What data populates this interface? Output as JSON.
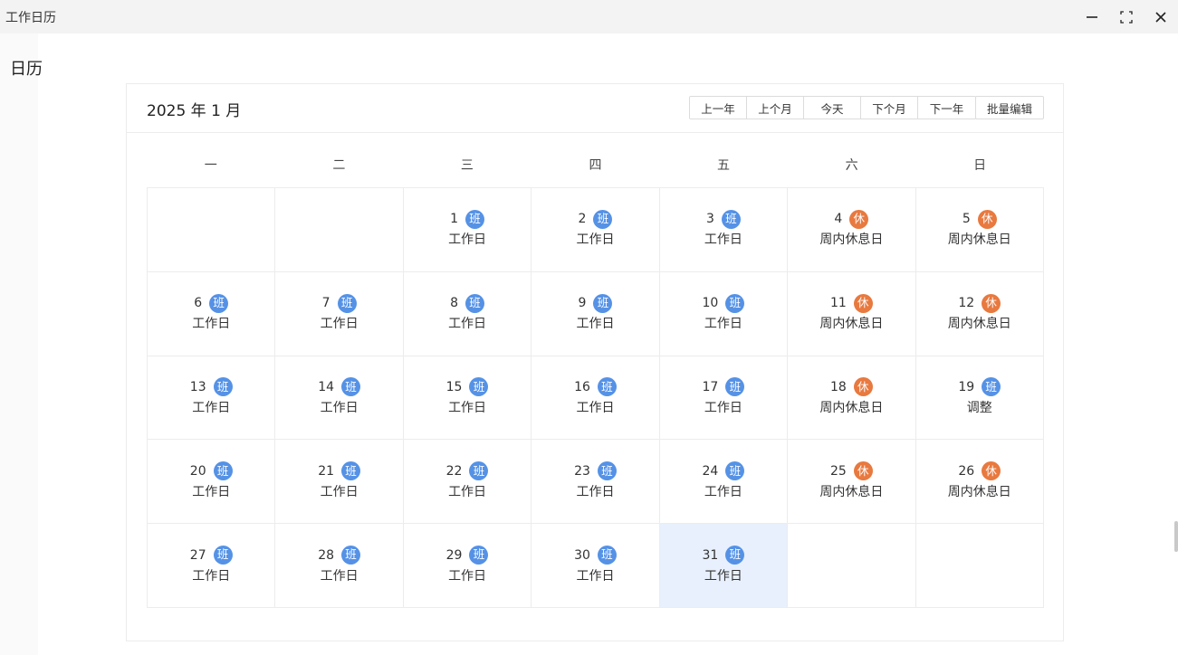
{
  "window": {
    "title": "工作日历",
    "controls": {
      "minimize": "minimize-icon",
      "maximize": "maximize-icon",
      "close": "close-icon"
    }
  },
  "page": {
    "title": "日历"
  },
  "calendar": {
    "month_title": "2025 年 1 月",
    "nav_buttons": [
      "上一年",
      "上个月",
      "今天",
      "下个月",
      "下一年"
    ],
    "batch_edit": "批量编辑",
    "weekdays": [
      "一",
      "二",
      "三",
      "四",
      "五",
      "六",
      "日"
    ],
    "badges": {
      "work": "班",
      "rest": "休"
    },
    "colors": {
      "work": "#5592e6",
      "rest": "#e8793f",
      "today_bg": "#e8f0fd"
    },
    "selected_day": "31",
    "days": [
      {
        "day": "",
        "type": "",
        "label": ""
      },
      {
        "day": "",
        "type": "",
        "label": ""
      },
      {
        "day": "1",
        "type": "work",
        "label": "工作日"
      },
      {
        "day": "2",
        "type": "work",
        "label": "工作日"
      },
      {
        "day": "3",
        "type": "work",
        "label": "工作日"
      },
      {
        "day": "4",
        "type": "rest",
        "label": "周内休息日"
      },
      {
        "day": "5",
        "type": "rest",
        "label": "周内休息日"
      },
      {
        "day": "6",
        "type": "work",
        "label": "工作日"
      },
      {
        "day": "7",
        "type": "work",
        "label": "工作日"
      },
      {
        "day": "8",
        "type": "work",
        "label": "工作日"
      },
      {
        "day": "9",
        "type": "work",
        "label": "工作日"
      },
      {
        "day": "10",
        "type": "work",
        "label": "工作日"
      },
      {
        "day": "11",
        "type": "rest",
        "label": "周内休息日"
      },
      {
        "day": "12",
        "type": "rest",
        "label": "周内休息日"
      },
      {
        "day": "13",
        "type": "work",
        "label": "工作日"
      },
      {
        "day": "14",
        "type": "work",
        "label": "工作日"
      },
      {
        "day": "15",
        "type": "work",
        "label": "工作日"
      },
      {
        "day": "16",
        "type": "work",
        "label": "工作日"
      },
      {
        "day": "17",
        "type": "work",
        "label": "工作日"
      },
      {
        "day": "18",
        "type": "rest",
        "label": "周内休息日"
      },
      {
        "day": "19",
        "type": "work",
        "label": "调整"
      },
      {
        "day": "20",
        "type": "work",
        "label": "工作日"
      },
      {
        "day": "21",
        "type": "work",
        "label": "工作日"
      },
      {
        "day": "22",
        "type": "work",
        "label": "工作日"
      },
      {
        "day": "23",
        "type": "work",
        "label": "工作日"
      },
      {
        "day": "24",
        "type": "work",
        "label": "工作日"
      },
      {
        "day": "25",
        "type": "rest",
        "label": "周内休息日"
      },
      {
        "day": "26",
        "type": "rest",
        "label": "周内休息日"
      },
      {
        "day": "27",
        "type": "work",
        "label": "工作日"
      },
      {
        "day": "28",
        "type": "work",
        "label": "工作日"
      },
      {
        "day": "29",
        "type": "work",
        "label": "工作日"
      },
      {
        "day": "30",
        "type": "work",
        "label": "工作日"
      },
      {
        "day": "31",
        "type": "work",
        "label": "工作日"
      },
      {
        "day": "",
        "type": "",
        "label": ""
      },
      {
        "day": "",
        "type": "",
        "label": ""
      }
    ]
  }
}
